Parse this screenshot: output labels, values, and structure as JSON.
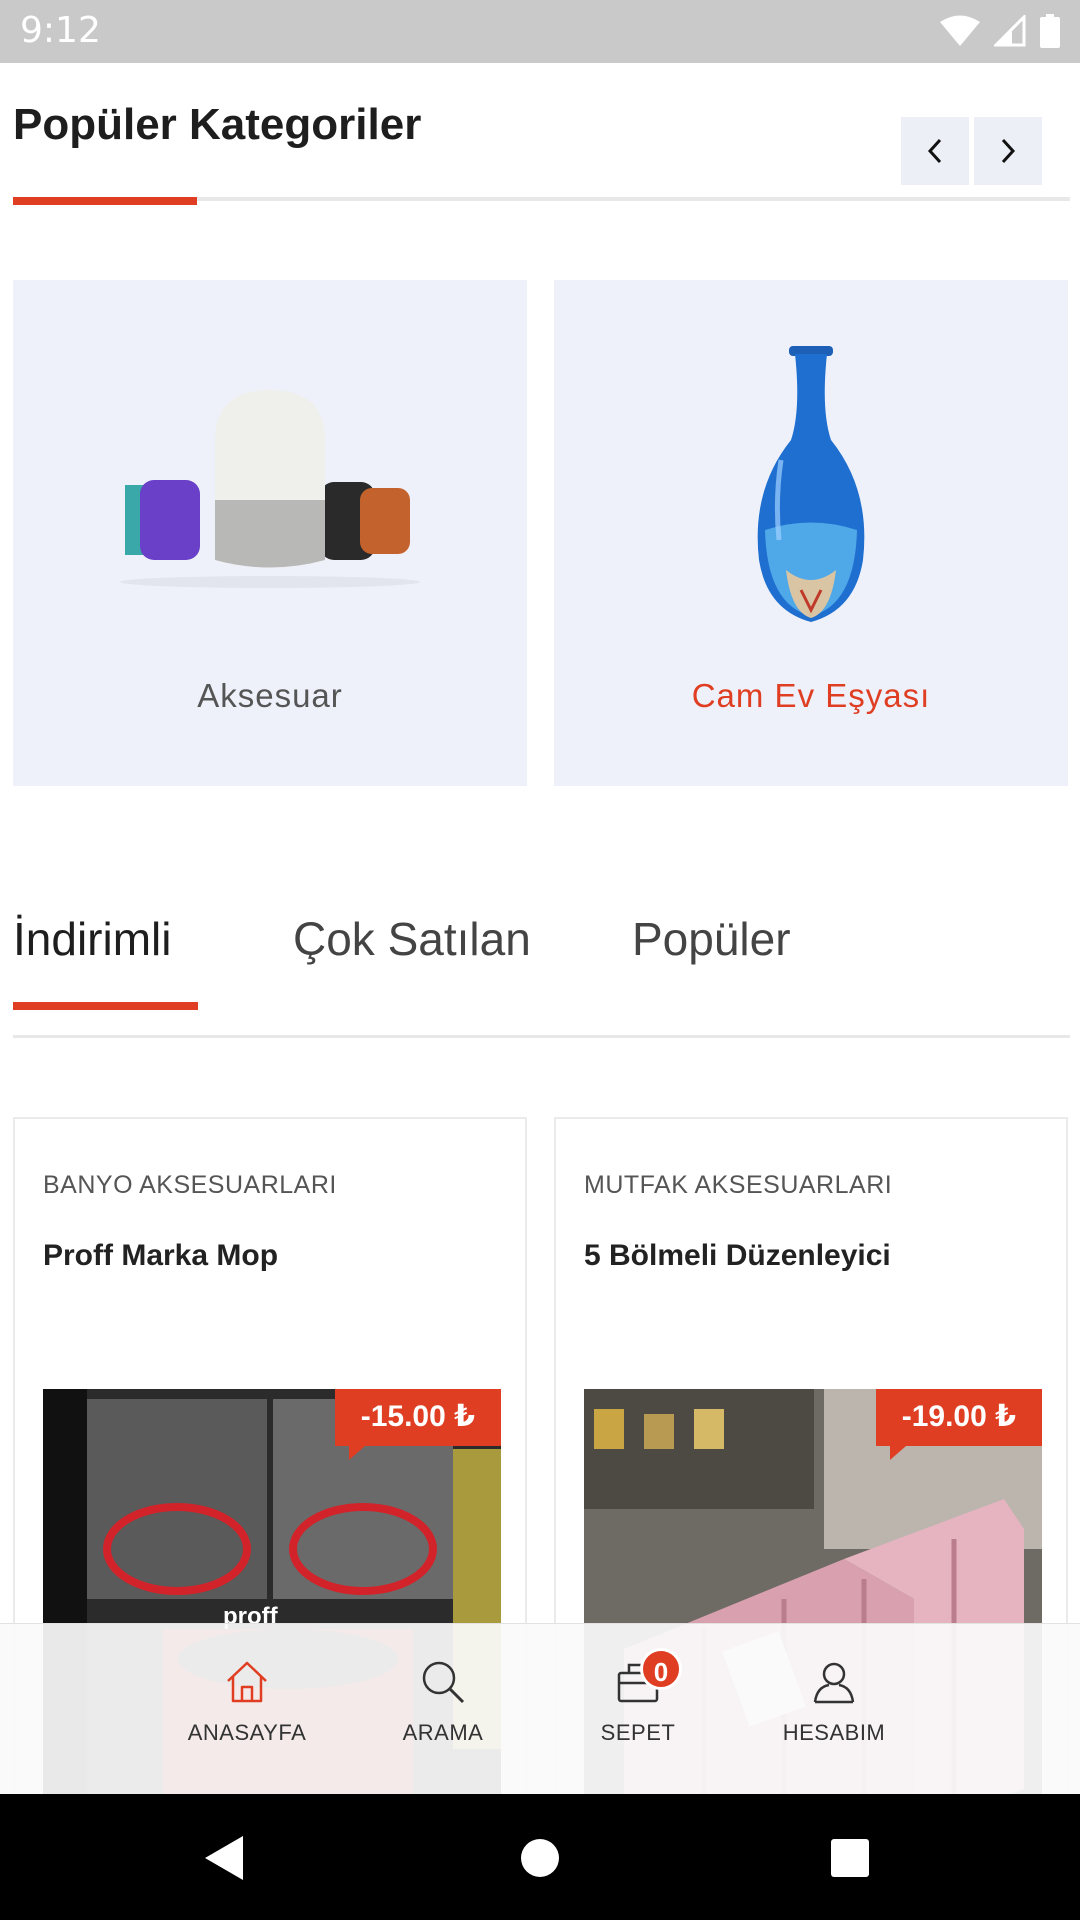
{
  "status_bar": {
    "time": "9:12"
  },
  "section": {
    "title": "Popüler Kategoriler"
  },
  "categories": [
    {
      "label": "Aksesuar",
      "image": "smart-speaker",
      "active": false
    },
    {
      "label": "Cam Ev Eşyası",
      "image": "glass-vase",
      "active": true
    }
  ],
  "tabs": [
    {
      "label": "İndirimli",
      "active": true
    },
    {
      "label": "Çok Satılan",
      "active": false
    },
    {
      "label": "Popüler",
      "active": false
    }
  ],
  "products": [
    {
      "category": "BANYO AKSESUARLARI",
      "name": "Proff Marka Mop",
      "discount": "-15.00 ₺",
      "image": "mop-boxes"
    },
    {
      "category": "MUTFAK AKSESUARLARI",
      "name": "5 Bölmeli Düzenleyici",
      "discount": "-19.00 ₺",
      "image": "pink-organizer"
    }
  ],
  "bottom_nav": {
    "home": "ANASAYFA",
    "search": "ARAMA",
    "cart": "SEPET",
    "cart_count": "0",
    "account": "HESABIM"
  },
  "colors": {
    "accent": "#e03e22",
    "card_bg": "#eef1fa",
    "status_bar": "#c9c9c9"
  }
}
